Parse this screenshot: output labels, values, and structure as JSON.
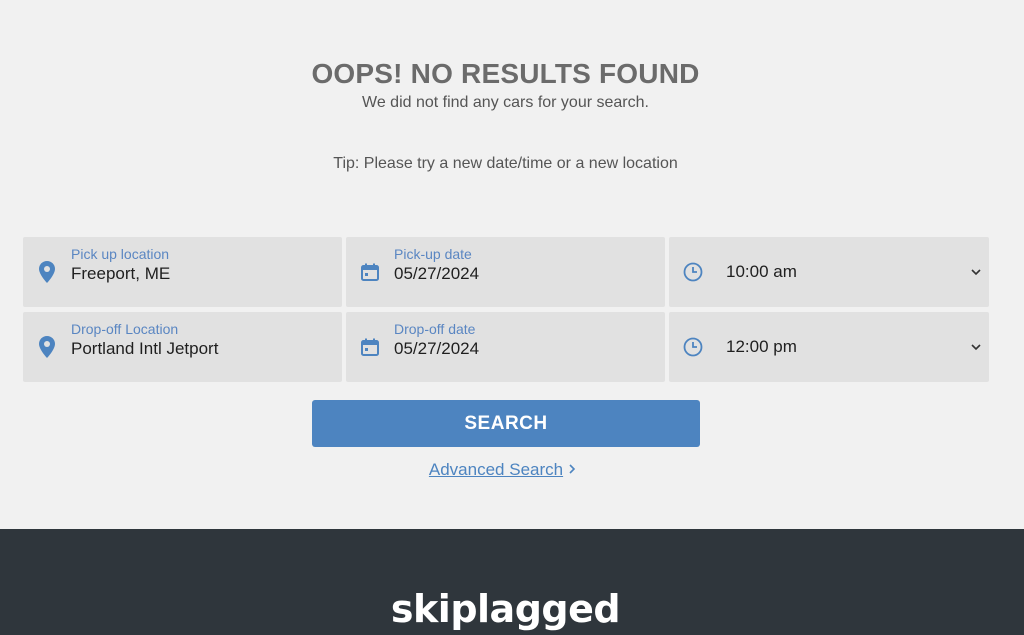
{
  "heading": "OOPS! NO RESULTS FOUND",
  "subheading": "We did not find any cars for your search.",
  "tip": "Tip: Please try a new date/time or a new location",
  "form": {
    "pickup_location": {
      "label": "Pick up location",
      "value": "Freeport, ME",
      "icon": "map-pin-icon"
    },
    "pickup_date": {
      "label": "Pick-up date",
      "value": "05/27/2024",
      "icon": "calendar-icon"
    },
    "pickup_time": {
      "value": "10:00 am",
      "icon": "clock-icon"
    },
    "dropoff_location": {
      "label": "Drop-off Location",
      "value": "Portland Intl Jetport",
      "icon": "map-pin-icon"
    },
    "dropoff_date": {
      "label": "Drop-off date",
      "value": "05/27/2024",
      "icon": "calendar-icon"
    },
    "dropoff_time": {
      "value": "12:00 pm",
      "icon": "clock-icon"
    }
  },
  "search_button": "SEARCH",
  "advanced_search": "Advanced Search",
  "footer": {
    "logo": "skiplagged"
  },
  "colors": {
    "accent": "#4d84c0",
    "background": "#f1f1f1",
    "field_bg": "#e1e1e1",
    "footer_bg": "#2f363c"
  }
}
